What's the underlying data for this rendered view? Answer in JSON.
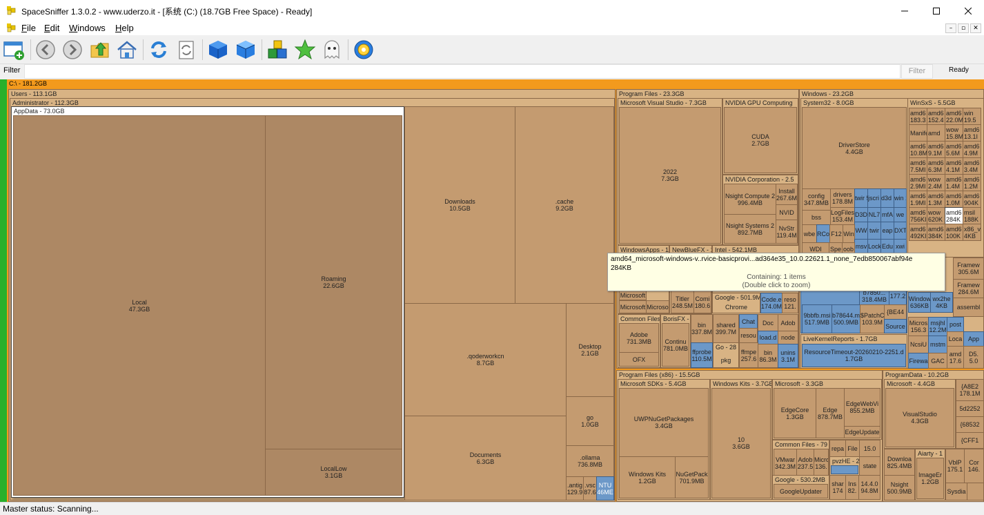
{
  "window": {
    "title": "SpaceSniffer 1.3.0.2 - www.uderzo.it - [系统 (C:) (18.7GB Free Space) - Ready]"
  },
  "menu": [
    "File",
    "Edit",
    "Windows",
    "Help"
  ],
  "menu_access_keys": [
    "F",
    "E",
    "W",
    "H"
  ],
  "menu_rest": [
    "ile",
    "dit",
    "indows",
    "elp"
  ],
  "mdi_buttons": [
    "–",
    "▫",
    "✕"
  ],
  "toolbar": {
    "buttons": [
      "new-view-icon",
      "back-icon",
      "forward-icon",
      "parent-folder-icon",
      "home-icon",
      "refresh-icon",
      "refresh-partial-icon",
      "blue-cube-icon",
      "blue-cube-outline-icon",
      "color-cubes-icon",
      "star-icon",
      "ghost-icon",
      "settings-gear-icon"
    ]
  },
  "filter": {
    "label": "Filter",
    "value": "",
    "button": "Filter",
    "status": "Ready"
  },
  "treemap": {
    "root": "C:\\ - 181.2GB",
    "users": "Users - 113.1GB",
    "administrator": "Administrator - 112.3GB",
    "appdata": "AppData - 73.0GB",
    "local": {
      "name": "Local",
      "size": "47.3GB"
    },
    "roaming": {
      "name": "Roaming",
      "size": "22.6GB"
    },
    "locallow": {
      "name": "LocalLow",
      "size": "3.1GB"
    },
    "downloads": {
      "name": "Downloads",
      "size": "10.5GB"
    },
    "cache": {
      "name": ".cache",
      "size": "9.2GB"
    },
    "qoder": {
      "name": ".qoderworkcn",
      "size": "8.7GB"
    },
    "desktop": {
      "name": "Desktop",
      "size": "2.1GB"
    },
    "documents": {
      "name": "Documents",
      "size": "6.3GB"
    },
    "go": {
      "name": "go",
      "size": "1.0GB"
    },
    "ollama": {
      "name": ".ollama",
      "size": "736.8MB"
    },
    "antig": {
      "name": ".antig",
      "size": "129.9"
    },
    "vsc": {
      "name": ".vsc",
      "size": "87.6"
    },
    "ntu": {
      "name": "NTU",
      "size": "46ME"
    },
    "program_files": "Program Files - 23.3GB",
    "msvs": "Microsoft Visual Studio - 7.3GB",
    "vs2022": {
      "name": "2022",
      "size": "7.3GB"
    },
    "nvidia_gpu": "NVIDIA GPU Computing",
    "cuda": {
      "name": "CUDA",
      "size": "2.7GB"
    },
    "nvidia_corp": "NVIDIA Corporation - 2.5",
    "nsight_compute": {
      "name": "Nsight Compute 2",
      "size": "996.4MB"
    },
    "installer": {
      "name": "Install",
      "size": "267.6M"
    },
    "nvid": {
      "name": "NVID",
      "size": ""
    },
    "nsight_systems": {
      "name": "Nsight Systems 2",
      "size": "892.7MB"
    },
    "nvstr": {
      "name": "NvStr",
      "size": "119.4M"
    },
    "windowsapps": "WindowsApps - 1",
    "newbluefx": "NewBlueFX - 1",
    "intel": "Intel - 542.1MB",
    "micross": {
      "name": "Microsoft",
      "size": ""
    },
    "titler": {
      "name": "Titler",
      "size": "248.5M"
    },
    "comm": {
      "name": "Comi",
      "size": "180.6"
    },
    "google_pf": "Google - 501.9M",
    "chrome": "Chrome",
    "code": {
      "name": "Code.e",
      "size": "174.0M"
    },
    "reso": {
      "name": "reso",
      "size": "121."
    },
    "microsoft_a": "Microsoft",
    "microsoft_b": "Microso",
    "common_files": "Common Files",
    "adobe": {
      "name": "Adobe",
      "size": "731.3MB"
    },
    "ofx": "OFX",
    "borisfx": "BorisFX -",
    "continu": {
      "name": "Continu",
      "size": "781.0MB"
    },
    "bin1": {
      "name": "bin",
      "size": "337.8M"
    },
    "ffprobe": {
      "name": "ffprobe",
      "size": "110.5M"
    },
    "shared": {
      "name": "shared",
      "size": "399.7M"
    },
    "chat": "Chat",
    "resou": "resou",
    "doc": "Doc",
    "adob": "Adob",
    "load": "load.d",
    "node": "node",
    "go_pf": "Go - 28",
    "ffmpe": {
      "name": "ffmpe",
      "size": "257.6"
    },
    "bin2": {
      "name": "bin",
      "size": "86.3M"
    },
    "unin": {
      "name": "unins",
      "size": "3.1M"
    },
    "pkg": "pkg",
    "windows": "Windows - 23.2GB",
    "system32": "System32 - 8.0GB",
    "driverstore": {
      "name": "DriverStore",
      "size": "4.4GB"
    },
    "config": {
      "name": "config",
      "size": "347.8MB"
    },
    "drivers": {
      "name": "drivers",
      "size": "178.8M"
    },
    "bss": "bss",
    "logfiles": {
      "name": "LogFiles",
      "size": "153.4M"
    },
    "winsxs": "WinSxS - 5.5GB",
    "livekernel": "LiveKernelReports - 1.7GB",
    "resourcetimeout": {
      "name": "ResourceTimeout-20260210-2251.d",
      "size": "1.7GB"
    },
    "framew1": {
      "name": "Framew",
      "size": "305.6M"
    },
    "framew2": {
      "name": "Framew",
      "size": "284.6M"
    },
    "window": {
      "name": "Window",
      "size": "636KB"
    },
    "wx2he": {
      "name": "wx2he",
      "size": "4KB"
    },
    "assembl": "assembl",
    "b7850": {
      "name": "b7850...",
      "size": "318.4MB"
    },
    "mb177": {
      "name": "",
      "size": "177.2"
    },
    "9bbfb": {
      "name": "9bbfb.msi",
      "size": "517.9MB"
    },
    "b78644": {
      "name": "b78644.m",
      "size": "500.9MB"
    },
    "patch": {
      "name": "$PatchC",
      "size": "103.9M"
    },
    "be44": "{BE44",
    "source": "Source",
    "micro1": {
      "name": "Micros",
      "size": "156.3"
    },
    "msjhl": {
      "name": "msjhl",
      "size": "12.2M"
    },
    "post": "post",
    "ncsiu": "NcsiU",
    "mstm": "mstm",
    "loca": "Loca",
    "app": "App",
    "firewa": "Firewa",
    "gac": "GAC",
    "amd_last": {
      "name": "amd",
      "size": "17.6"
    },
    "d5": {
      "name": "D5.",
      "size": "5.0"
    },
    "program_files_x86": "Program Files (x86) - 15.5GB",
    "ms_sdks": "Microsoft SDKs - 5.4GB",
    "uwpnuget": {
      "name": "UWPNuGetPackages",
      "size": "3.4GB"
    },
    "windows_kits_inner": {
      "name": "Windows Kits",
      "size": "1.2GB"
    },
    "nugetpack": {
      "name": "NuGetPack",
      "size": "701.9MB"
    },
    "windows_kits": "Windows Kits - 3.7GE",
    "wk10": {
      "name": "10",
      "size": "3.6GB"
    },
    "microsoft_x86": "Microsoft - 3.3GB",
    "edgecore": {
      "name": "EdgeCore",
      "size": "1.3GB"
    },
    "edge": {
      "name": "Edge",
      "size": "878.7MB"
    },
    "edgewebview": {
      "name": "EdgeWebVi",
      "size": "855.2MB"
    },
    "edgeupdate": "EdgeUpdate",
    "common_files_x86": "Common Files - 79",
    "vmware": {
      "name": "VMwar",
      "size": "342.3M"
    },
    "adob_x86": {
      "name": "Adob",
      "size": "237.5"
    },
    "micr_x86": {
      "name": "Micro",
      "size": "136."
    },
    "repa": "repa",
    "file": "File",
    "n15": "15.0",
    "pvzhe": "pvzHE - 2",
    "state": "state",
    "google_x86": "Google - 530.2MB",
    "googleupdater": "GoogleUpdater",
    "shar": {
      "name": "shar",
      "size": "174"
    },
    "ins": {
      "name": "Ins",
      "size": "82."
    },
    "n144": {
      "name": "14.4.0",
      "size": "94.8M"
    },
    "programdata": "ProgramData - 10.2GB",
    "microsoft_pd": "Microsoft - 4.4GB",
    "visualstudio": {
      "name": "VisualStudio",
      "size": "4.3GB"
    },
    "downlo": {
      "name": "Downloa",
      "size": "825.4MB"
    },
    "aiarty": "Aiarty - 1",
    "imageer": {
      "name": "ImageEr",
      "size": "1.2GB"
    },
    "nsight_pd": {
      "name": "Nsight",
      "size": "500.9MB"
    },
    "vblp": {
      "name": "VblP",
      "size": "175.1"
    },
    "cor": {
      "name": "Cor",
      "size": "146."
    },
    "sysdia": "Sysdia",
    "a8e2": {
      "name": "{A8E2",
      "size": "178.1M"
    },
    "n5d22": "5d2252",
    "n6853": "{68532",
    "cff1": "{CFF1"
  },
  "tooltip": {
    "name": "amd64_microsoft-windows-v..rvice-basicprovi...ad364e35_10.0.22621.1_none_7edb850067abf94e",
    "size": "284KB",
    "containing": "Containing: 1 items",
    "hint": "(Double click to zoom)"
  },
  "winsxs_cells": [
    [
      "amd6",
      "183.3",
      "amd6",
      "152.4",
      "amd6",
      "22.0M",
      "win",
      "19.5"
    ],
    [
      "Manife",
      "",
      "amd",
      "",
      "wow",
      "15.8M",
      "amd6",
      "13.1I"
    ],
    [
      "amd6",
      "10.8M",
      "amd6",
      "9.1M",
      "amd6",
      "5.6M",
      "amd6",
      "4.9M"
    ],
    [
      "amd6",
      "7.5MI",
      "amd6",
      "6.3M",
      "amd6",
      "4.1M",
      "amd6",
      "3.4M"
    ],
    [
      "amd6",
      "2.9MI",
      "wow",
      "2.4M",
      "amd6",
      "1.4M",
      "amd6",
      "1.2M"
    ],
    [
      "amd6",
      "1.9MI",
      "amd6",
      "1.3M",
      "amd6",
      "1.0M",
      "amd6",
      "904K"
    ],
    [
      "amd6",
      "756KI",
      "wow",
      "620K",
      "amd6",
      "284K",
      "msil",
      "188K"
    ],
    [
      "amd6",
      "492KI",
      "amd6",
      "384K",
      "amd6",
      "100K",
      "x86_v",
      "4KB"
    ]
  ],
  "system32_cells": {
    "twir": "twir 5.4",
    "jscri": "jscri 4.9",
    "d3d": "d3d 2.4",
    "win": "win 1.9",
    "d3d2": "D3D",
    "nl7": "NL7",
    "mfa": "mfA",
    "we": "we",
    "ww": "WW",
    "twir2": "twir",
    "eap": "eap",
    "dxt": "DXT",
    "msv": "msv",
    "lock": "Lock",
    "edu": "Edu",
    "xwi": "xwi",
    "wbe": "wbe",
    "rc": "RCo",
    "f12": "F12",
    "win2": "Win",
    "wdi": "WDI",
    "spe": "Spe",
    "oob": "oob"
  },
  "status": {
    "text": "Master status: Scanning..."
  }
}
